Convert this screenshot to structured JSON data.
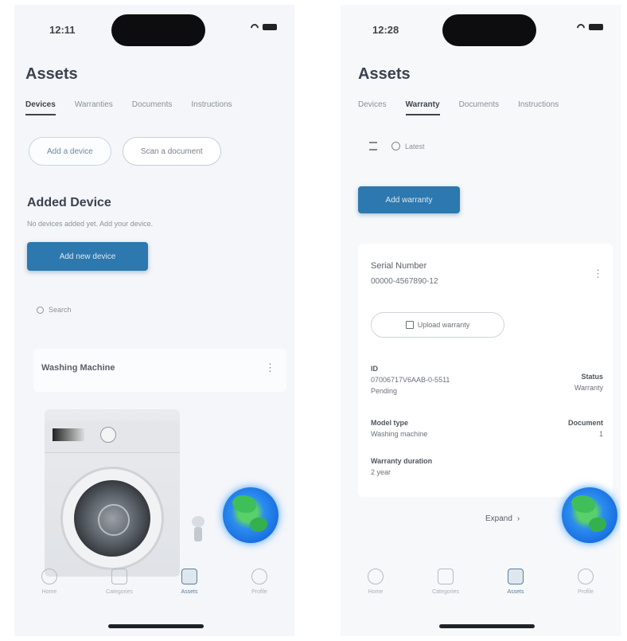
{
  "left_screen": {
    "status": {
      "time": "12:11"
    },
    "title": "Assets",
    "tabs": [
      "Devices",
      "Warranties",
      "Documents",
      "Instructions"
    ],
    "chips": [
      "Add a device",
      "Scan a document"
    ],
    "section_title": "Added Device",
    "section_subtitle": "No devices added yet. Add your device.",
    "primary_button": "Add new device",
    "search_placeholder": "Search",
    "device_name": "Washing Machine",
    "bottom_nav": [
      "Home",
      "Categories",
      "Assets",
      "Profile"
    ]
  },
  "right_screen": {
    "status": {
      "time": "12:28"
    },
    "title": "Assets",
    "tabs": [
      "Devices",
      "Warranty",
      "Documents",
      "Instructions"
    ],
    "filter_label": "Filter",
    "sort_label": "Latest",
    "primary_button": "Add warranty",
    "record_title": "Serial Number",
    "record_subtitle": "00000-4567890-12",
    "edit_button": "Upload warranty",
    "fields": {
      "id_label": "ID",
      "id_value": "07006717V6AAB-0-5511",
      "id_sub": "Pending",
      "status_label": "Status",
      "status_value": "Warranty",
      "model_label": "Model type",
      "model_value": "Washing machine",
      "doc_label": "Document",
      "warranty_label": "Warranty duration",
      "warranty_value": "2 year",
      "doc_value": "1"
    },
    "expand_label": "Expand",
    "bottom_nav": [
      "Home",
      "Categories",
      "Assets",
      "Profile"
    ]
  }
}
